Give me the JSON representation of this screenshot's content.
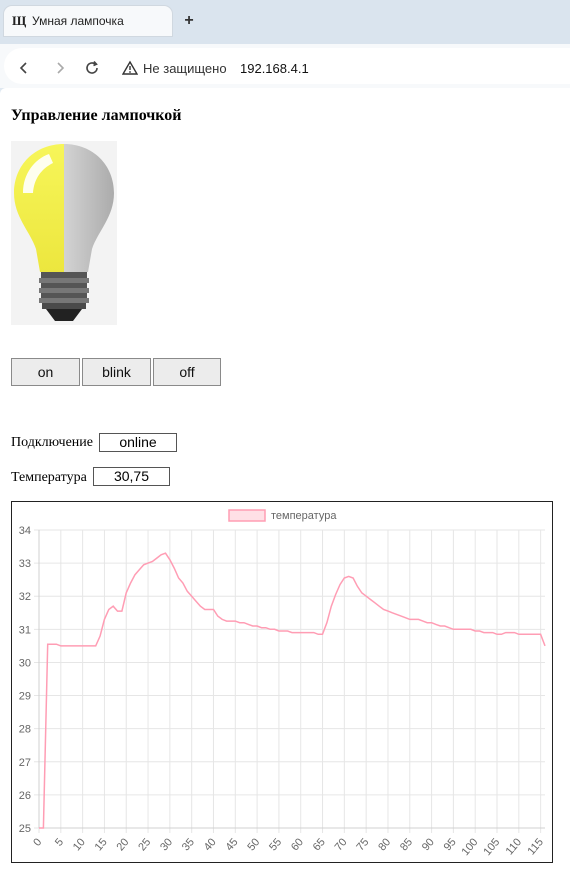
{
  "browser": {
    "tab_title": "Умная лампочка",
    "tab_icon_glyph": "Щ",
    "new_tab_glyph": "+",
    "security_label": "Не защищено",
    "url": "192.168.4.1",
    "icons": [
      "back-arrow-icon",
      "forward-arrow-icon",
      "reload-icon",
      "warning-icon"
    ]
  },
  "page": {
    "title": "Управление лампочкой",
    "buttons": {
      "on": "on",
      "blink": "blink",
      "off": "off"
    },
    "connection": {
      "label": "Подключение",
      "value": "online"
    },
    "temperature": {
      "label": "Температура",
      "value": "30,75"
    }
  },
  "colors": {
    "line": "#ff9db4",
    "legend_fill": "#ffe0e6",
    "grid": "#e6e6e6",
    "bulb_lit": "#f5f24a",
    "bulb_off": "#c4c4c4"
  },
  "chart_data": {
    "type": "line",
    "legend": [
      "температура"
    ],
    "legend_position": "top",
    "grid": true,
    "x_tick_labels": [
      "0",
      "5",
      "10",
      "15",
      "20",
      "25",
      "30",
      "35",
      "40",
      "45",
      "50",
      "55",
      "60",
      "65",
      "70",
      "75",
      "80",
      "85",
      "90",
      "95",
      "100",
      "105",
      "110",
      "115"
    ],
    "y_tick_labels": [
      "25",
      "26",
      "27",
      "28",
      "29",
      "30",
      "31",
      "32",
      "33",
      "34"
    ],
    "xlim": [
      0,
      116
    ],
    "ylim": [
      25,
      34
    ],
    "series": [
      {
        "name": "температура",
        "x": [
          0,
          1,
          2,
          3,
          4,
          5,
          6,
          7,
          8,
          9,
          10,
          11,
          12,
          13,
          14,
          15,
          16,
          17,
          18,
          19,
          20,
          21,
          22,
          23,
          24,
          25,
          26,
          27,
          28,
          29,
          30,
          31,
          32,
          33,
          34,
          35,
          36,
          37,
          38,
          39,
          40,
          41,
          42,
          43,
          44,
          45,
          46,
          47,
          48,
          49,
          50,
          51,
          52,
          53,
          54,
          55,
          56,
          57,
          58,
          59,
          60,
          61,
          62,
          63,
          64,
          65,
          66,
          67,
          68,
          69,
          70,
          71,
          72,
          73,
          74,
          75,
          76,
          77,
          78,
          79,
          80,
          81,
          82,
          83,
          84,
          85,
          86,
          87,
          88,
          89,
          90,
          91,
          92,
          93,
          94,
          95,
          96,
          97,
          98,
          99,
          100,
          101,
          102,
          103,
          104,
          105,
          106,
          107,
          108,
          109,
          110,
          111,
          112,
          113,
          114,
          115,
          116
        ],
        "values": [
          25,
          25,
          30.55,
          30.55,
          30.55,
          30.5,
          30.5,
          30.5,
          30.5,
          30.5,
          30.5,
          30.5,
          30.5,
          30.5,
          30.8,
          31.3,
          31.6,
          31.7,
          31.55,
          31.55,
          32.1,
          32.4,
          32.65,
          32.8,
          32.95,
          33.0,
          33.05,
          33.15,
          33.25,
          33.3,
          33.1,
          32.85,
          32.55,
          32.4,
          32.15,
          32.0,
          31.85,
          31.7,
          31.6,
          31.6,
          31.6,
          31.4,
          31.3,
          31.25,
          31.25,
          31.25,
          31.2,
          31.2,
          31.15,
          31.1,
          31.1,
          31.05,
          31.05,
          31.0,
          31.0,
          30.95,
          30.95,
          30.95,
          30.9,
          30.9,
          30.9,
          30.9,
          30.9,
          30.9,
          30.85,
          30.85,
          31.2,
          31.7,
          32.05,
          32.35,
          32.55,
          32.6,
          32.55,
          32.3,
          32.1,
          32.0,
          31.9,
          31.8,
          31.7,
          31.6,
          31.55,
          31.5,
          31.45,
          31.4,
          31.35,
          31.3,
          31.3,
          31.3,
          31.25,
          31.2,
          31.2,
          31.15,
          31.1,
          31.1,
          31.05,
          31.0,
          31.0,
          31.0,
          31.0,
          31.0,
          30.95,
          30.95,
          30.9,
          30.9,
          30.9,
          30.85,
          30.85,
          30.9,
          30.9,
          30.9,
          30.85,
          30.85,
          30.85,
          30.85,
          30.85,
          30.85,
          30.5
        ]
      }
    ]
  }
}
